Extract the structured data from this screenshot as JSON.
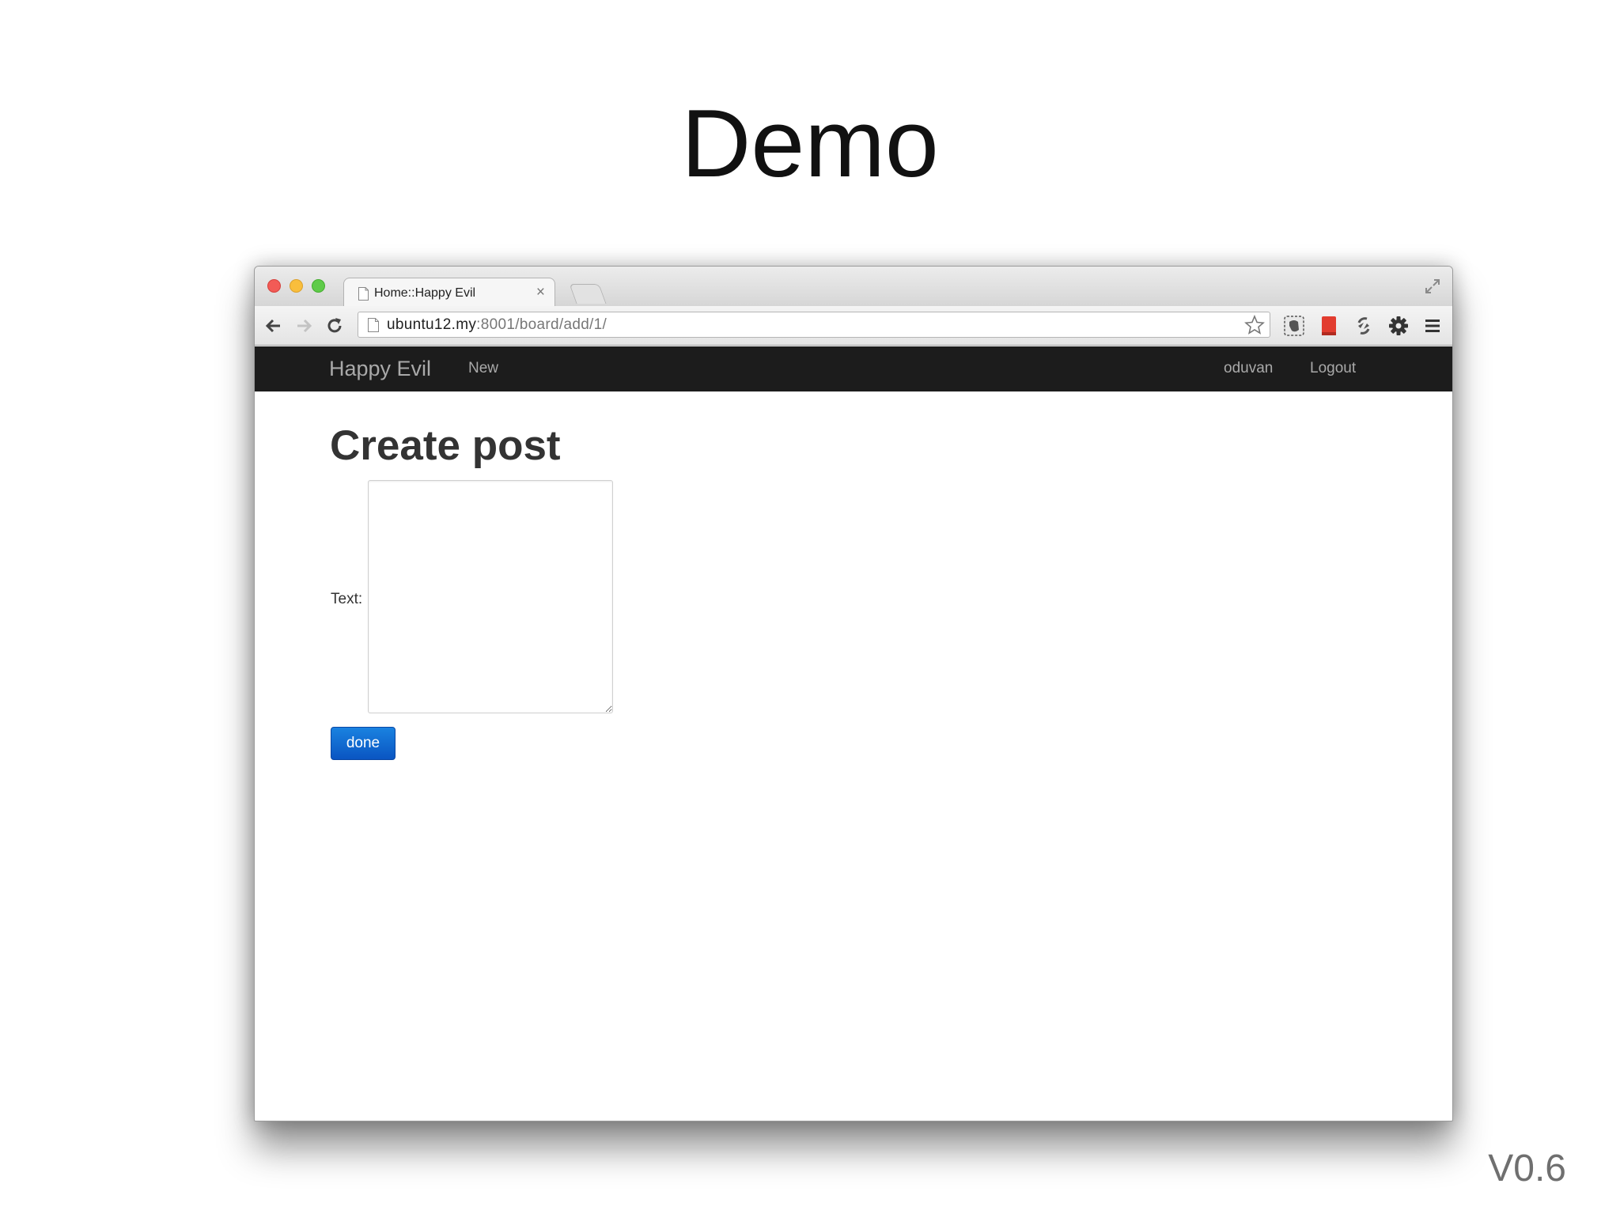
{
  "slide": {
    "title": "Demo",
    "version": "V0.6"
  },
  "browser": {
    "tab": {
      "title": "Home::Happy Evil",
      "close_glyph": "×"
    },
    "omnibox": {
      "url_host": "ubuntu12.my",
      "url_rest": ":8001/board/add/1/"
    },
    "icons": {
      "back": "back-arrow-icon",
      "forward": "forward-arrow-icon",
      "reload": "reload-icon",
      "page": "page-icon",
      "bookmark": "star-icon",
      "extensions": [
        "evernote-icon",
        "bookmark-extension-icon",
        "sync-extension-icon",
        "gear-icon",
        "menu-icon"
      ],
      "fullscreen": "fullscreen-icon"
    }
  },
  "site": {
    "navbar": {
      "brand": "Happy Evil",
      "links": [
        "New"
      ],
      "user": "oduvan",
      "logout": "Logout"
    },
    "form": {
      "heading": "Create post",
      "text_label": "Text:",
      "text_value": "",
      "submit_label": "done"
    }
  },
  "colors": {
    "navbar_bg": "#1c1c1c",
    "navbar_text": "#a9a9a9",
    "primary_button": "#0d62d0",
    "heading_text": "#333333"
  }
}
